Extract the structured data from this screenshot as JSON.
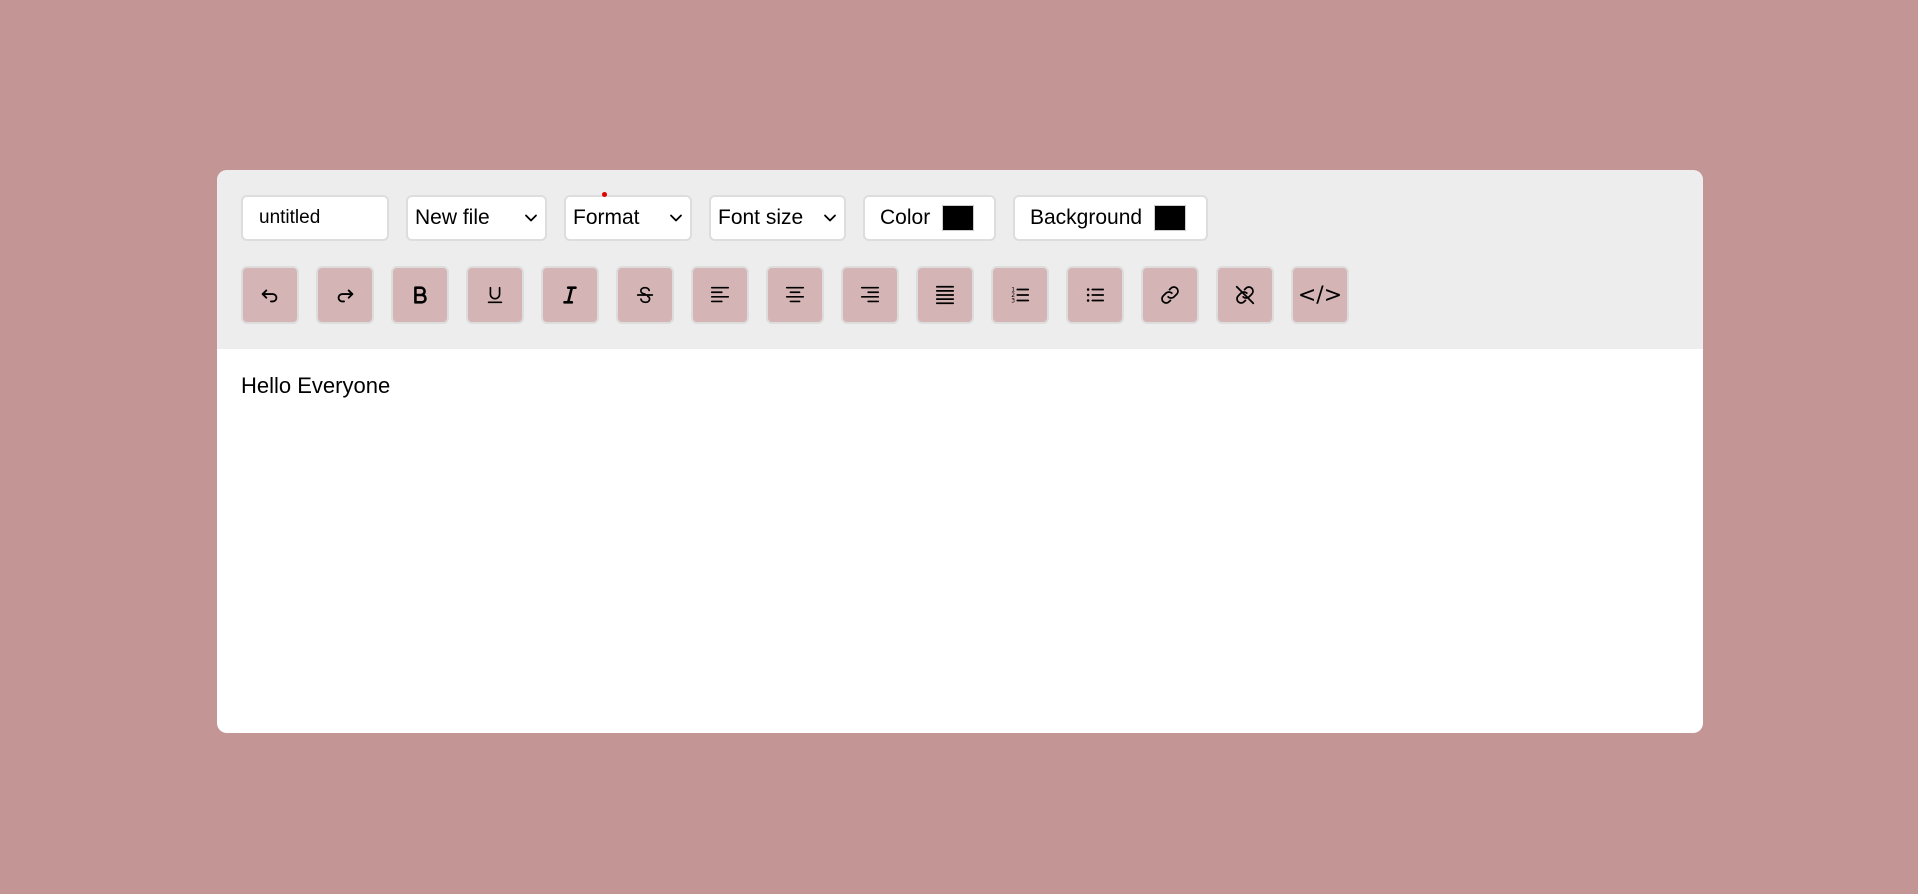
{
  "colors": {
    "background": "#c49595",
    "toolbar": "#ededed",
    "button": "#d4b4b4",
    "swatch": "#000000"
  },
  "toolbar": {
    "filename_value": "untitled",
    "new_file_label": "New file",
    "format_label": "Format",
    "font_size_label": "Font size",
    "color_label": "Color",
    "background_label": "Background",
    "buttons": [
      {
        "icon": "undo-icon"
      },
      {
        "icon": "redo-icon"
      },
      {
        "icon": "bold-icon"
      },
      {
        "icon": "underline-icon"
      },
      {
        "icon": "italic-icon"
      },
      {
        "icon": "strikethrough-icon"
      },
      {
        "icon": "align-left-icon"
      },
      {
        "icon": "align-center-icon"
      },
      {
        "icon": "align-right-icon"
      },
      {
        "icon": "align-justify-icon"
      },
      {
        "icon": "ordered-list-icon"
      },
      {
        "icon": "unordered-list-icon"
      },
      {
        "icon": "link-icon"
      },
      {
        "icon": "unlink-icon"
      },
      {
        "icon": "code-icon",
        "text": "</>"
      }
    ]
  },
  "content": {
    "text": "Hello Everyone"
  }
}
